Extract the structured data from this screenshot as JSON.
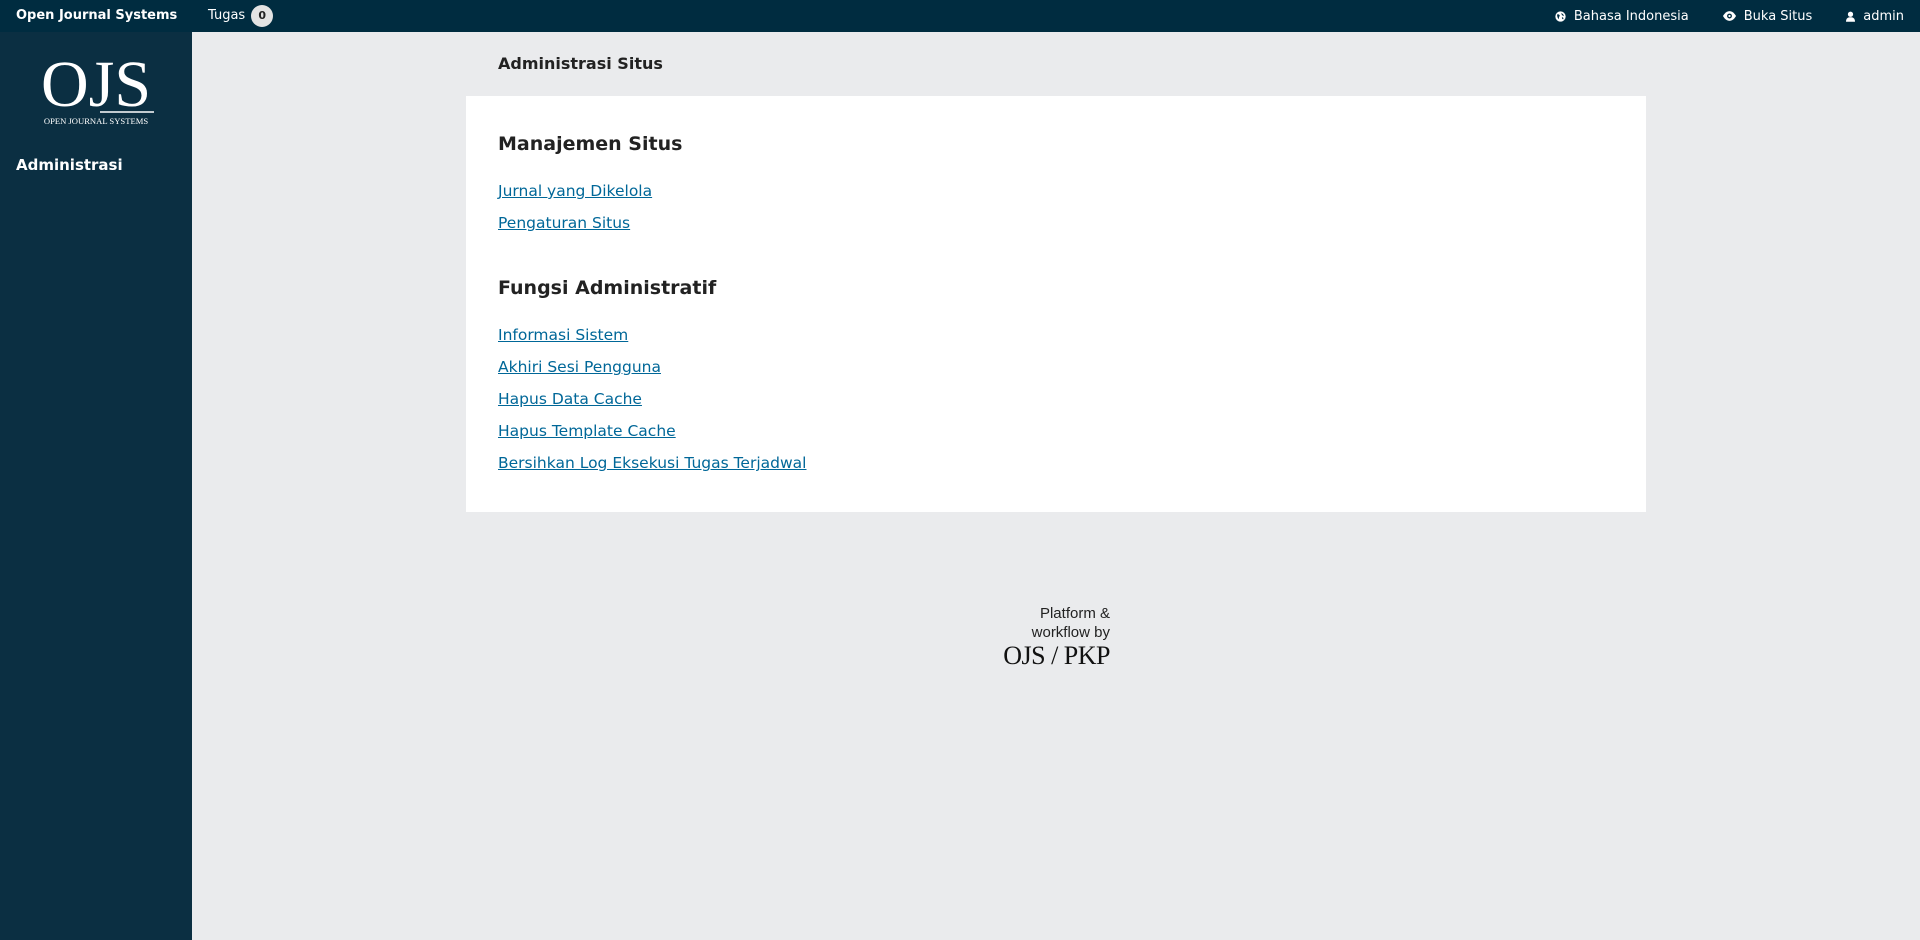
{
  "topbar": {
    "app_name": "Open Journal Systems",
    "tasks_label": "Tugas",
    "tasks_count": "0",
    "language": "Bahasa Indonesia",
    "view_site": "Buka Situs",
    "user": "admin"
  },
  "sidebar": {
    "logo_text": "OJS",
    "logo_subtitle": "OPEN JOURNAL SYSTEMS",
    "items": [
      {
        "label": "Administrasi"
      }
    ]
  },
  "main": {
    "page_title": "Administrasi Situs",
    "sections": [
      {
        "heading": "Manajemen Situs",
        "links": [
          "Jurnal yang Dikelola",
          "Pengaturan Situs"
        ]
      },
      {
        "heading": "Fungsi Administratif",
        "links": [
          "Informasi Sistem",
          "Akhiri Sesi Pengguna",
          "Hapus Data Cache",
          "Hapus Template Cache",
          "Bersihkan Log Eksekusi Tugas Terjadwal"
        ]
      }
    ]
  },
  "footer": {
    "line1": "Platform &",
    "line2": "workflow by",
    "brand": "OJS / PKP"
  },
  "colors": {
    "topbar": "#002c40",
    "sidebar": "#0b2f42",
    "link": "#006798",
    "background": "#eaebed"
  }
}
